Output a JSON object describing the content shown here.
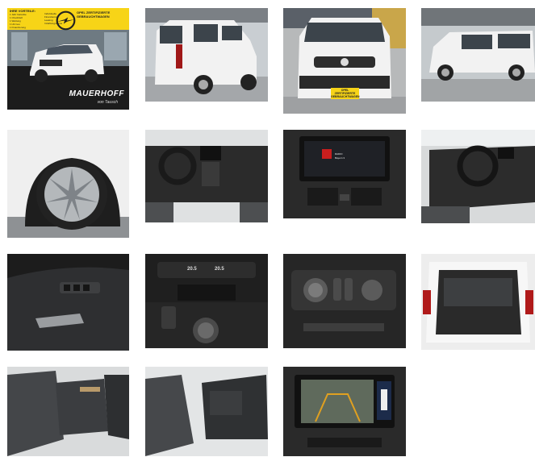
{
  "gallery": {
    "photos": [
      {
        "name": "photo-front-showroom"
      },
      {
        "name": "photo-rear-quarter"
      },
      {
        "name": "photo-front"
      },
      {
        "name": "photo-side"
      },
      {
        "name": "photo-wheel"
      },
      {
        "name": "photo-dashboard"
      },
      {
        "name": "photo-infotainment"
      },
      {
        "name": "photo-steering-wheel"
      },
      {
        "name": "photo-door-panel"
      },
      {
        "name": "photo-climate-control"
      },
      {
        "name": "photo-light-switches"
      },
      {
        "name": "photo-trunk"
      },
      {
        "name": "photo-rear-seats"
      },
      {
        "name": "photo-front-seats"
      },
      {
        "name": "photo-rear-camera"
      }
    ]
  },
  "banner": {
    "title": "IHRE VORTEILE:",
    "items": [
      "1 Jahr Garantie",
      "1 Checkheft",
      "1 Wartung",
      "1 HU neu",
      "1 Finanzierung"
    ],
    "mid_items": [
      "Individuelle",
      "Finanzierung",
      "Leasing",
      "Inzahlungnahme"
    ],
    "badge": "OPEL ZERTIFIZIERTE GEBRAUCHTWAGEN"
  },
  "dealer": {
    "name": "MAUERHOFF",
    "sub": "von Tausch"
  },
  "plate": {
    "text": "OPEL ZERTIFIZIERTE GEBRAUCHTWAGEN"
  },
  "infotainment": {
    "station": "RADIO",
    "line": "Bayern 3"
  },
  "climate": {
    "left_temp": "20.5",
    "right_temp": "20.5"
  },
  "colors": {
    "car_white": "#f2f2f2",
    "opel_yellow": "#f7d417",
    "interior_dark": "#2b2b2b"
  }
}
